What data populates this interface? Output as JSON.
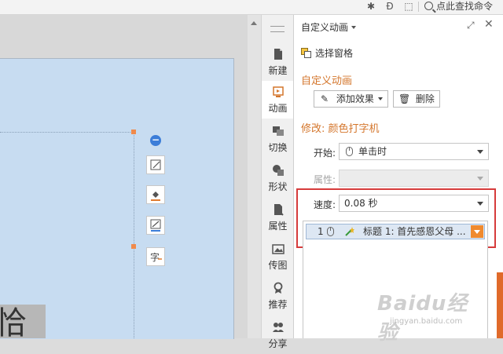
{
  "topbar": {
    "search_label": "点此查找命令"
  },
  "slide": {
    "partial_text": "恰"
  },
  "sidebar": {
    "tabs": [
      {
        "label": "新建",
        "icon": "new-page-icon"
      },
      {
        "label": "动画",
        "icon": "animation-icon",
        "active": true
      },
      {
        "label": "切换",
        "icon": "transition-icon"
      },
      {
        "label": "形状",
        "icon": "shape-icon"
      },
      {
        "label": "属性",
        "icon": "properties-icon"
      },
      {
        "label": "传图",
        "icon": "image-upload-icon"
      },
      {
        "label": "推荐",
        "icon": "recommend-icon"
      },
      {
        "label": "分享",
        "icon": "share-icon"
      }
    ]
  },
  "panel": {
    "title": "自定义动画",
    "select_pane": "选择窗格",
    "section_title": "自定义动画",
    "add_effect": "添加效果",
    "delete": "删除",
    "modify_title": "修改: 颜色打字机",
    "start_label": "开始:",
    "start_value": "单击时",
    "property_label": "属性:",
    "speed_label": "速度:",
    "speed_value": "0.08 秒",
    "list": [
      {
        "index": "1",
        "text": "标题 1: 首先感恩父母 ..."
      }
    ]
  },
  "watermark": {
    "brand": "Baidu经验",
    "url": "jingyan.baidu.com"
  },
  "colors": {
    "accent": "#d4762c",
    "highlight_box": "#d63b3b",
    "slide_bg": "#c7dcf1"
  }
}
